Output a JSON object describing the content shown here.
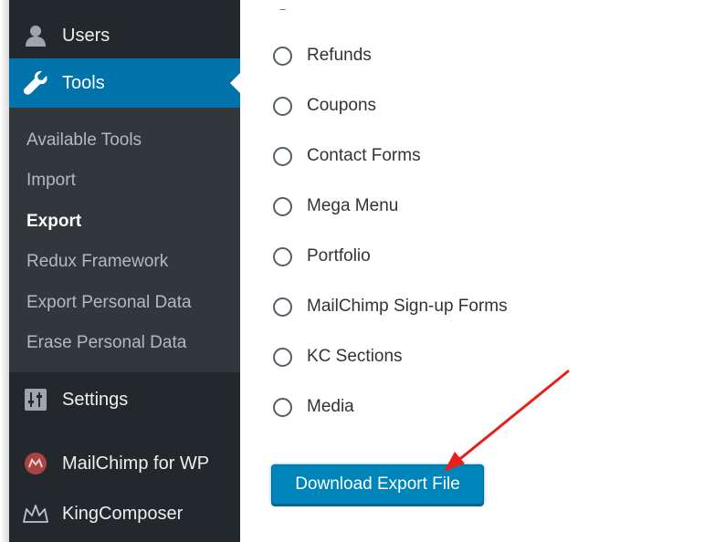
{
  "sidebar": {
    "users_label": "Users",
    "tools_label": "Tools",
    "submenu": [
      {
        "label": "Available Tools"
      },
      {
        "label": "Import"
      },
      {
        "label": "Export"
      },
      {
        "label": "Redux Framework"
      },
      {
        "label": "Export Personal Data"
      },
      {
        "label": "Erase Personal Data"
      }
    ],
    "settings_label": "Settings",
    "mailchimp_label": "MailChimp for WP",
    "kingcomposer_label": "KingComposer"
  },
  "export": {
    "options": [
      {
        "label": "Refunds"
      },
      {
        "label": "Coupons"
      },
      {
        "label": "Contact Forms"
      },
      {
        "label": "Mega Menu"
      },
      {
        "label": "Portfolio"
      },
      {
        "label": "MailChimp Sign-up Forms"
      },
      {
        "label": "KC Sections"
      },
      {
        "label": "Media"
      }
    ],
    "download_label": "Download Export File"
  },
  "colors": {
    "sidebar_bg": "#23282d",
    "submenu_bg": "#32373c",
    "active_bg": "#0073aa",
    "button_bg": "#0085ba",
    "annotation_arrow": "#e8201b"
  },
  "icons": [
    "user-icon",
    "wrench-icon",
    "settings-sliders-icon",
    "mailchimp-icon",
    "kingcomposer-crown-icon",
    "red-arrow-annotation"
  ]
}
